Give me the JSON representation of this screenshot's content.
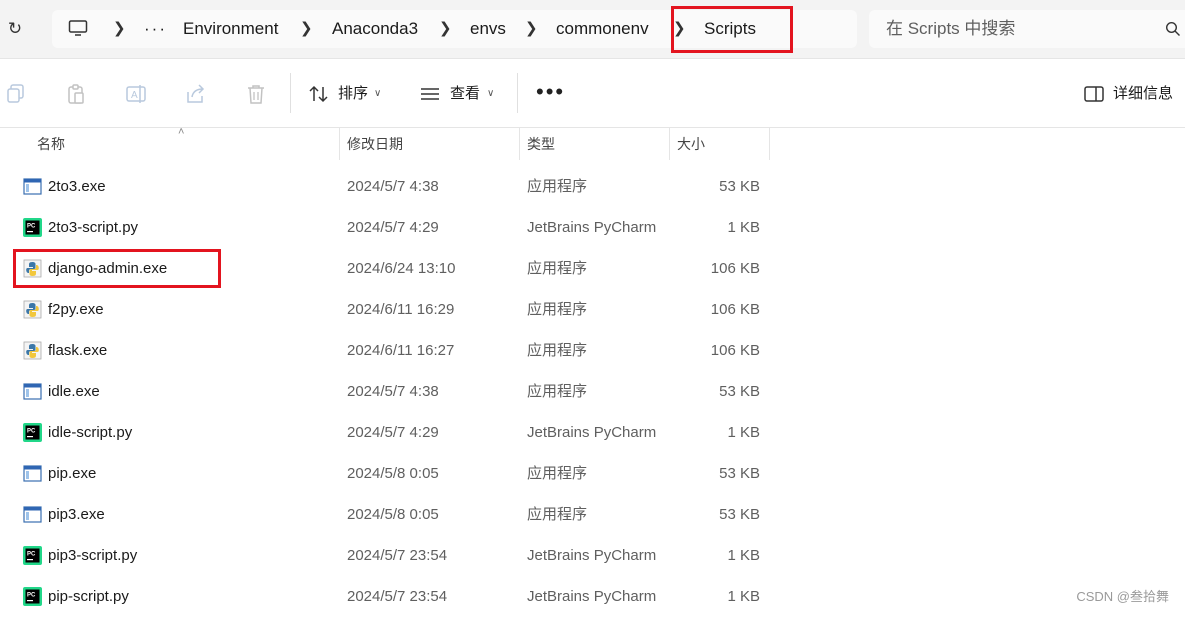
{
  "address_bar": {
    "crumbs": [
      "Environment",
      "Anaconda3",
      "envs",
      "commonenv",
      "Scripts"
    ],
    "more_label": "···"
  },
  "search": {
    "placeholder": "在 Scripts 中搜索"
  },
  "toolbar": {
    "sort_label": "排序",
    "view_label": "查看",
    "more_label": "•••",
    "details_label": "详细信息"
  },
  "columns": {
    "name": "名称",
    "date": "修改日期",
    "type": "类型",
    "size": "大小"
  },
  "files": [
    {
      "name": "2to3.exe",
      "date": "2024/5/7 4:38",
      "type": "应用程序",
      "size": "53 KB",
      "icon": "exe-window-icon"
    },
    {
      "name": "2to3-script.py",
      "date": "2024/5/7 4:29",
      "type": "JetBrains PyCharm",
      "size": "1 KB",
      "icon": "pycharm-icon"
    },
    {
      "name": "django-admin.exe",
      "date": "2024/6/24 13:10",
      "type": "应用程序",
      "size": "106 KB",
      "icon": "python-exe-icon"
    },
    {
      "name": "f2py.exe",
      "date": "2024/6/11 16:29",
      "type": "应用程序",
      "size": "106 KB",
      "icon": "python-exe-icon"
    },
    {
      "name": "flask.exe",
      "date": "2024/6/11 16:27",
      "type": "应用程序",
      "size": "106 KB",
      "icon": "python-exe-icon"
    },
    {
      "name": "idle.exe",
      "date": "2024/5/7 4:38",
      "type": "应用程序",
      "size": "53 KB",
      "icon": "exe-window-icon"
    },
    {
      "name": "idle-script.py",
      "date": "2024/5/7 4:29",
      "type": "JetBrains PyCharm",
      "size": "1 KB",
      "icon": "pycharm-icon"
    },
    {
      "name": "pip.exe",
      "date": "2024/5/8 0:05",
      "type": "应用程序",
      "size": "53 KB",
      "icon": "exe-window-icon"
    },
    {
      "name": "pip3.exe",
      "date": "2024/5/8 0:05",
      "type": "应用程序",
      "size": "53 KB",
      "icon": "exe-window-icon"
    },
    {
      "name": "pip3-script.py",
      "date": "2024/5/7 23:54",
      "type": "JetBrains PyCharm",
      "size": "1 KB",
      "icon": "pycharm-icon"
    },
    {
      "name": "pip-script.py",
      "date": "2024/5/7 23:54",
      "type": "JetBrains PyCharm",
      "size": "1 KB",
      "icon": "pycharm-icon"
    }
  ],
  "watermark": "CSDN @叁拾舞",
  "colors": {
    "highlight": "#e3141f",
    "background": "#ffffff",
    "chrome": "#f3f3f3"
  }
}
